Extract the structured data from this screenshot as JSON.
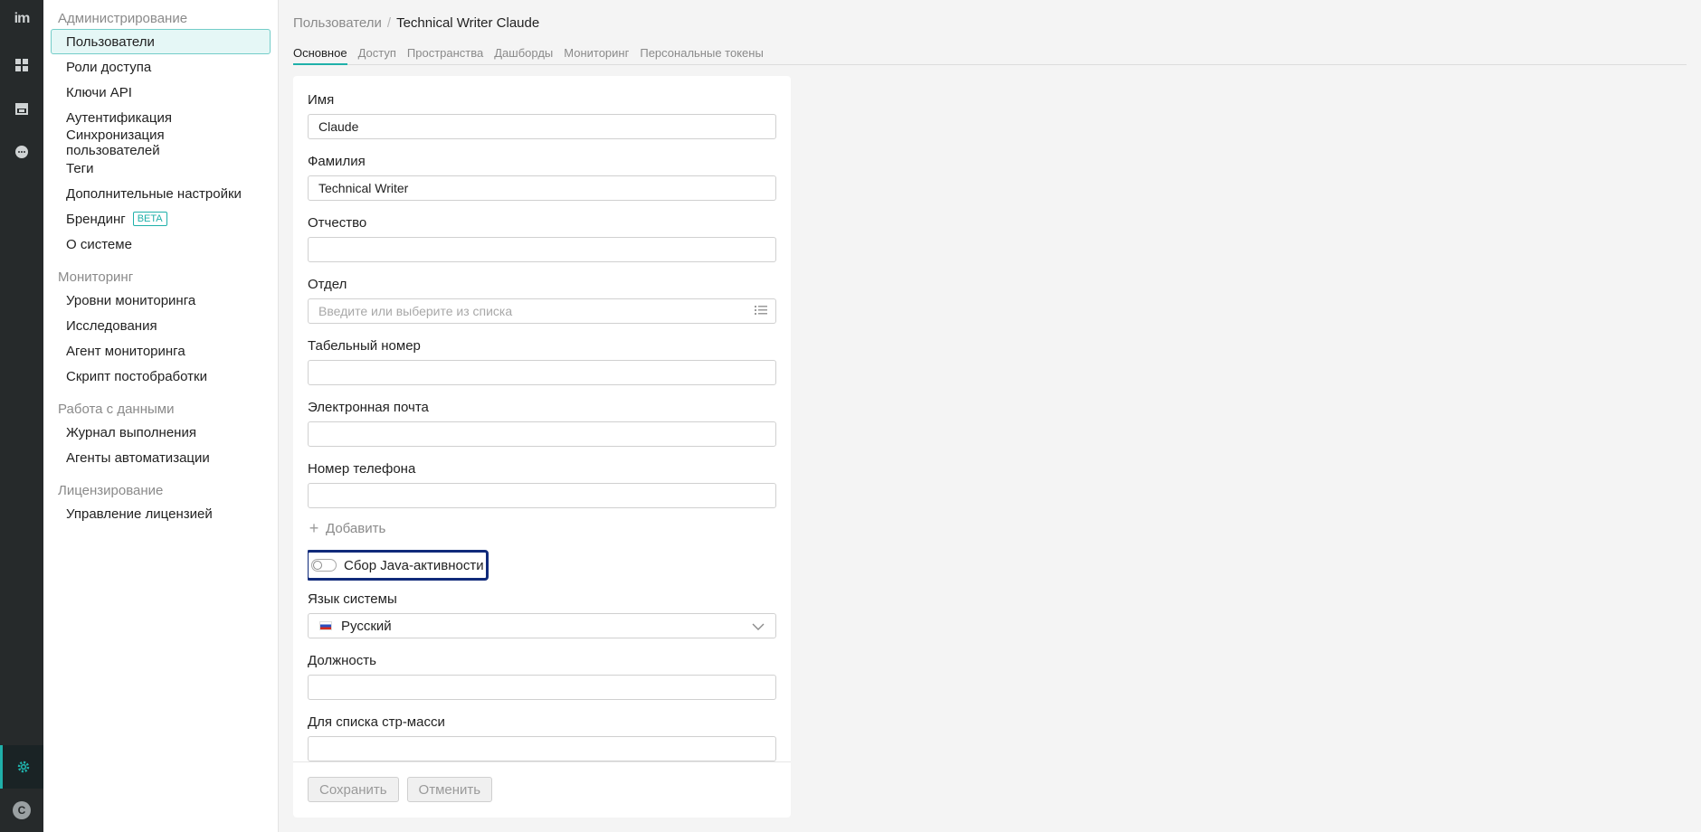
{
  "rail": {
    "logo": "im",
    "avatar_letter": "C",
    "accent_color": "#1fb0aa"
  },
  "sidebar": {
    "sections": [
      {
        "title": "Администрирование",
        "items": [
          {
            "label": "Пользователи",
            "selected": true
          },
          {
            "label": "Роли доступа"
          },
          {
            "label": "Ключи API"
          },
          {
            "label": "Аутентификация"
          },
          {
            "label": "Синхронизация пользователей"
          },
          {
            "label": "Теги"
          },
          {
            "label": "Дополнительные настройки"
          },
          {
            "label": "Брендинг",
            "badge": "BETA"
          },
          {
            "label": "О системе"
          }
        ]
      },
      {
        "title": "Мониторинг",
        "items": [
          {
            "label": "Уровни мониторинга"
          },
          {
            "label": "Исследования"
          },
          {
            "label": "Агент мониторинга"
          },
          {
            "label": "Скрипт постобработки"
          }
        ]
      },
      {
        "title": "Работа с данными",
        "items": [
          {
            "label": "Журнал выполнения"
          },
          {
            "label": "Агенты автоматизации"
          }
        ]
      },
      {
        "title": "Лицензирование",
        "items": [
          {
            "label": "Управление лицензией"
          }
        ]
      }
    ]
  },
  "breadcrumb": {
    "root": "Пользователи",
    "separator": "/",
    "current": "Technical Writer Claude"
  },
  "tabs": [
    {
      "label": "Основное",
      "active": true
    },
    {
      "label": "Доступ"
    },
    {
      "label": "Пространства"
    },
    {
      "label": "Дашборды"
    },
    {
      "label": "Мониторинг"
    },
    {
      "label": "Персональные токены"
    }
  ],
  "form": {
    "first_name": {
      "label": "Имя",
      "value": "Claude"
    },
    "last_name": {
      "label": "Фамилия",
      "value": "Technical Writer"
    },
    "middle_name": {
      "label": "Отчество",
      "value": ""
    },
    "department": {
      "label": "Отдел",
      "value": "",
      "placeholder": "Введите или выберите из списка"
    },
    "employee_number": {
      "label": "Табельный номер",
      "value": ""
    },
    "email": {
      "label": "Электронная почта",
      "value": ""
    },
    "phone": {
      "label": "Номер телефона",
      "value": ""
    },
    "add_label": "Добавить",
    "java_toggle": {
      "label": "Сбор Java-активности",
      "on": false
    },
    "language": {
      "label": "Язык системы",
      "value": "Русский"
    },
    "position": {
      "label": "Должность",
      "value": ""
    },
    "mass_list": {
      "label": "Для списка стр-масси",
      "value": ""
    }
  },
  "footer": {
    "save_label": "Сохранить",
    "cancel_label": "Отменить"
  }
}
